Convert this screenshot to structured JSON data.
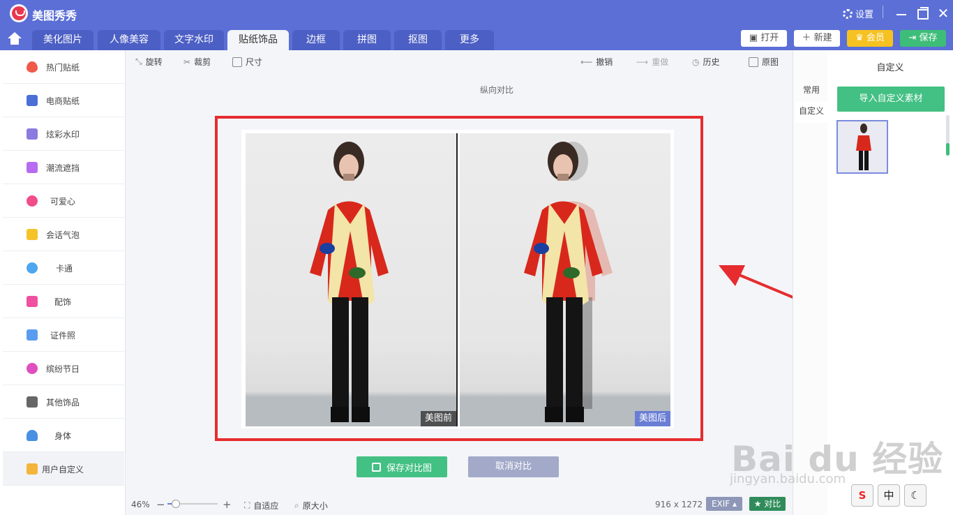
{
  "app": {
    "title": "美图秀秀",
    "settings_label": "设置"
  },
  "tabs": [
    {
      "label": "美化图片"
    },
    {
      "label": "人像美容"
    },
    {
      "label": "文字水印"
    },
    {
      "label": "贴纸饰品"
    },
    {
      "label": "边框"
    },
    {
      "label": "拼图"
    },
    {
      "label": "抠图"
    },
    {
      "label": "更多"
    }
  ],
  "active_tab": "贴纸饰品",
  "top_buttons": {
    "open": "打开",
    "new": "新建",
    "vip": "会员",
    "save": "保存"
  },
  "sidebar": {
    "items": [
      {
        "label": "热门贴纸",
        "icon": "flame-icon",
        "color": "#f05a4a"
      },
      {
        "label": "电商贴纸",
        "icon": "cart-icon",
        "color": "#4a6fd6"
      },
      {
        "label": "炫彩水印",
        "icon": "watermark-icon",
        "color": "#8a7be0"
      },
      {
        "label": "潮流遮挡",
        "icon": "pen-icon",
        "color": "#b76bf0"
      },
      {
        "label": "可爱心",
        "icon": "heart-icon",
        "color": "#f04d8a"
      },
      {
        "label": "会话气泡",
        "icon": "chat-bubble-icon",
        "color": "#f6c22a"
      },
      {
        "label": "卡通",
        "icon": "bear-icon",
        "color": "#4fa6f0"
      },
      {
        "label": "配饰",
        "icon": "bow-icon",
        "color": "#f050a0"
      },
      {
        "label": "证件照",
        "icon": "id-photo-icon",
        "color": "#5a9df0"
      },
      {
        "label": "缤纷节日",
        "icon": "balloon-icon",
        "color": "#e04fc0"
      },
      {
        "label": "其他饰品",
        "icon": "grid-icon",
        "color": "#666666"
      },
      {
        "label": "身体",
        "icon": "person-icon",
        "color": "#4a90e2"
      },
      {
        "label": "用户自定义",
        "icon": "edit-icon",
        "color": "#f3b53a"
      }
    ]
  },
  "toolbar": {
    "rotate": "旋转",
    "crop": "裁剪",
    "size": "尺寸",
    "undo": "撤销",
    "redo": "重做",
    "history": "历史",
    "original": "原图"
  },
  "compare": {
    "label": "纵向对比",
    "before_tag": "美图前",
    "after_tag": "美图后",
    "save_button": "保存对比图",
    "cancel_button": "取消对比"
  },
  "bottom": {
    "zoom": "46%",
    "zoom_level": 0.46,
    "fit": "自适应",
    "actual_size": "原大小",
    "dimensions": "916 x 1272",
    "exif": "EXIF",
    "contrast": "对比"
  },
  "right_panel": {
    "title": "自定义",
    "tab_common": "常用",
    "tab_custom": "自定义",
    "import_button": "导入自定义素材"
  },
  "watermark": {
    "main": "Bai du 经验",
    "sub": "jingyan.baidu.com"
  },
  "ime": {
    "sogou": "S",
    "zh": "中"
  },
  "colors": {
    "header": "#5b6fd6",
    "accent_green": "#43c083",
    "highlight_red": "#e62c2f"
  }
}
